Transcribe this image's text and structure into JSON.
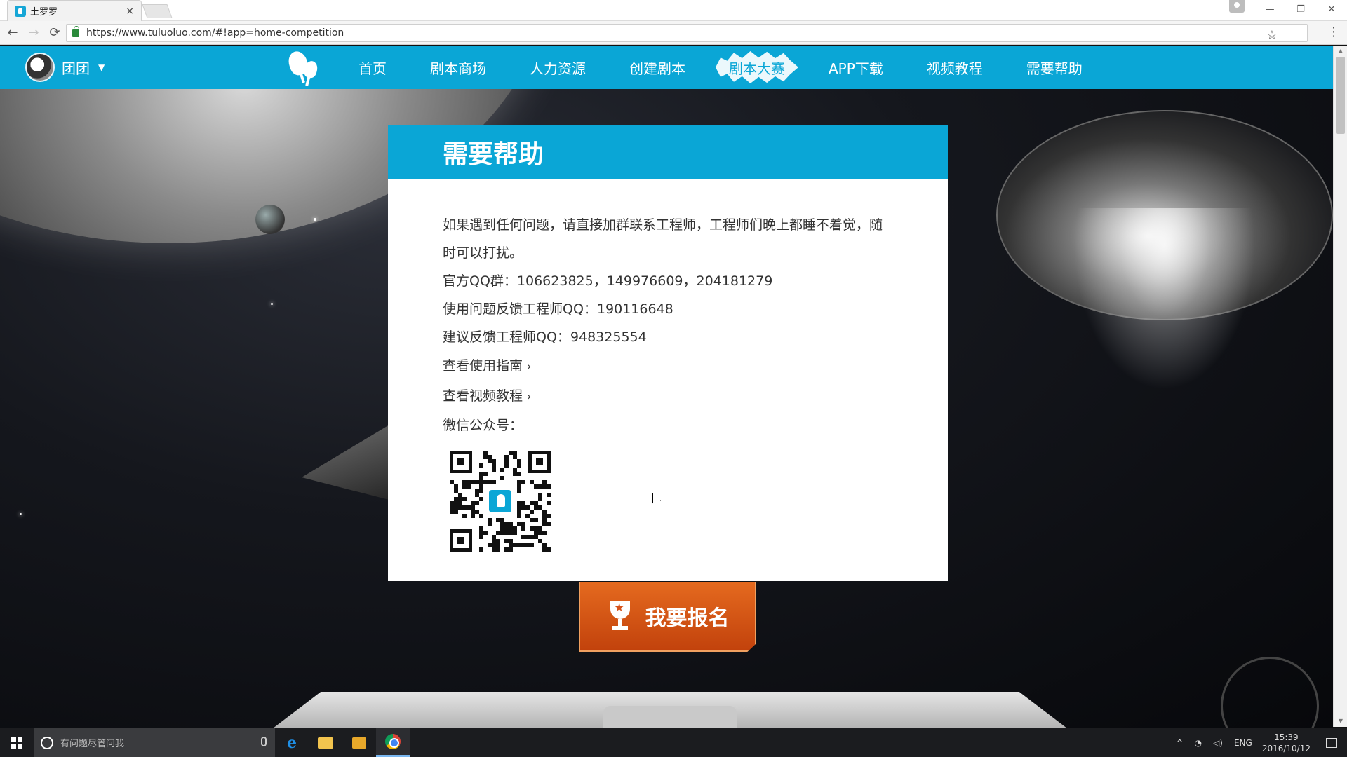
{
  "browser": {
    "tab_title": "土罗罗",
    "tab_close": "×",
    "url": "https://www.tuluoluo.com/#!app=home-competition",
    "window_controls": [
      "—",
      "❐",
      "✕"
    ]
  },
  "site": {
    "user_name": "团团",
    "nav": [
      {
        "label": "首页",
        "active": false
      },
      {
        "label": "剧本商场",
        "active": false
      },
      {
        "label": "人力资源",
        "active": false
      },
      {
        "label": "创建剧本",
        "active": false
      },
      {
        "label": "剧本大赛",
        "active": true
      },
      {
        "label": "APP下载",
        "active": false
      },
      {
        "label": "视频教程",
        "active": false
      },
      {
        "label": "需要帮助",
        "active": false
      }
    ],
    "brand_color": "#0aa6d6"
  },
  "help": {
    "title": "需要帮助",
    "intro": "如果遇到任何问题，请直接加群联系工程师，工程师们晚上都睡不着觉，随时可以打扰。",
    "qq_groups": "官方QQ群：106623825，149976609，204181279",
    "feedback_qq": "使用问题反馈工程师QQ：190116648",
    "suggest_qq": "建议反馈工程师QQ：948325554",
    "guide_link": "查看使用指南",
    "video_link": "查看视频教程",
    "link_chevron": "›",
    "wechat_label": "微信公众号："
  },
  "cta": {
    "label": "我要报名",
    "color": "#d6521a"
  },
  "taskbar": {
    "search_placeholder": "有问题尽管问我",
    "lang": "ENG",
    "time": "15:39",
    "date": "2016/10/12"
  }
}
